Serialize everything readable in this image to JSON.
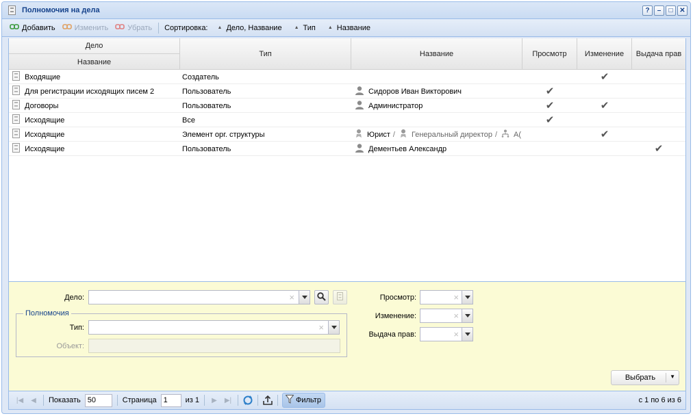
{
  "window": {
    "title": "Полномочия на дела"
  },
  "toolbar": {
    "add": "Добавить",
    "edit": "Изменить",
    "remove": "Убрать",
    "sort_label": "Сортировка:",
    "sort": [
      "Дело, Название",
      "Тип",
      "Название"
    ]
  },
  "grid": {
    "headers": {
      "case": "Дело",
      "case_name": "Название",
      "type": "Тип",
      "name": "Название",
      "view": "Просмотр",
      "change": "Изменение",
      "grant": "Выдача прав"
    },
    "rows": [
      {
        "name": "Входящие",
        "type": "Создатель",
        "object": [],
        "object_icon": "",
        "view": false,
        "change": true,
        "grant": false
      },
      {
        "name": "Для регистрации исходящих писем 2",
        "type": "Пользователь",
        "object": [
          "Сидоров Иван Викторович"
        ],
        "object_icon": "user-icon",
        "view": true,
        "change": false,
        "grant": false
      },
      {
        "name": "Договоры",
        "type": "Пользователь",
        "object": [
          "Администратор"
        ],
        "object_icon": "user-icon",
        "view": true,
        "change": true,
        "grant": false
      },
      {
        "name": "Исходящие",
        "type": "Все",
        "object": [],
        "object_icon": "",
        "view": true,
        "change": false,
        "grant": false
      },
      {
        "name": "Исходящие",
        "type": "Элемент орг. структуры",
        "object": [
          "Юрист",
          "Генеральный директор",
          "А("
        ],
        "object_icon": "position-icon",
        "view": false,
        "change": true,
        "grant": false
      },
      {
        "name": "Исходящие",
        "type": "Пользователь",
        "object": [
          "Дементьев Александр"
        ],
        "object_icon": "user-icon",
        "view": false,
        "change": false,
        "grant": true
      }
    ]
  },
  "filter": {
    "case_label": "Дело:",
    "group_legend": "Полномочия",
    "type_label": "Тип:",
    "object_label": "Объект:",
    "view_label": "Просмотр:",
    "change_label": "Изменение:",
    "grant_label": "Выдача прав:",
    "select_button": "Выбрать"
  },
  "pager": {
    "show_label": "Показать",
    "page_size": "50",
    "page_label": "Страница",
    "page": "1",
    "of_label": "из 1",
    "filter_toggle": "Фильтр",
    "info": "с 1 по 6 из 6"
  }
}
